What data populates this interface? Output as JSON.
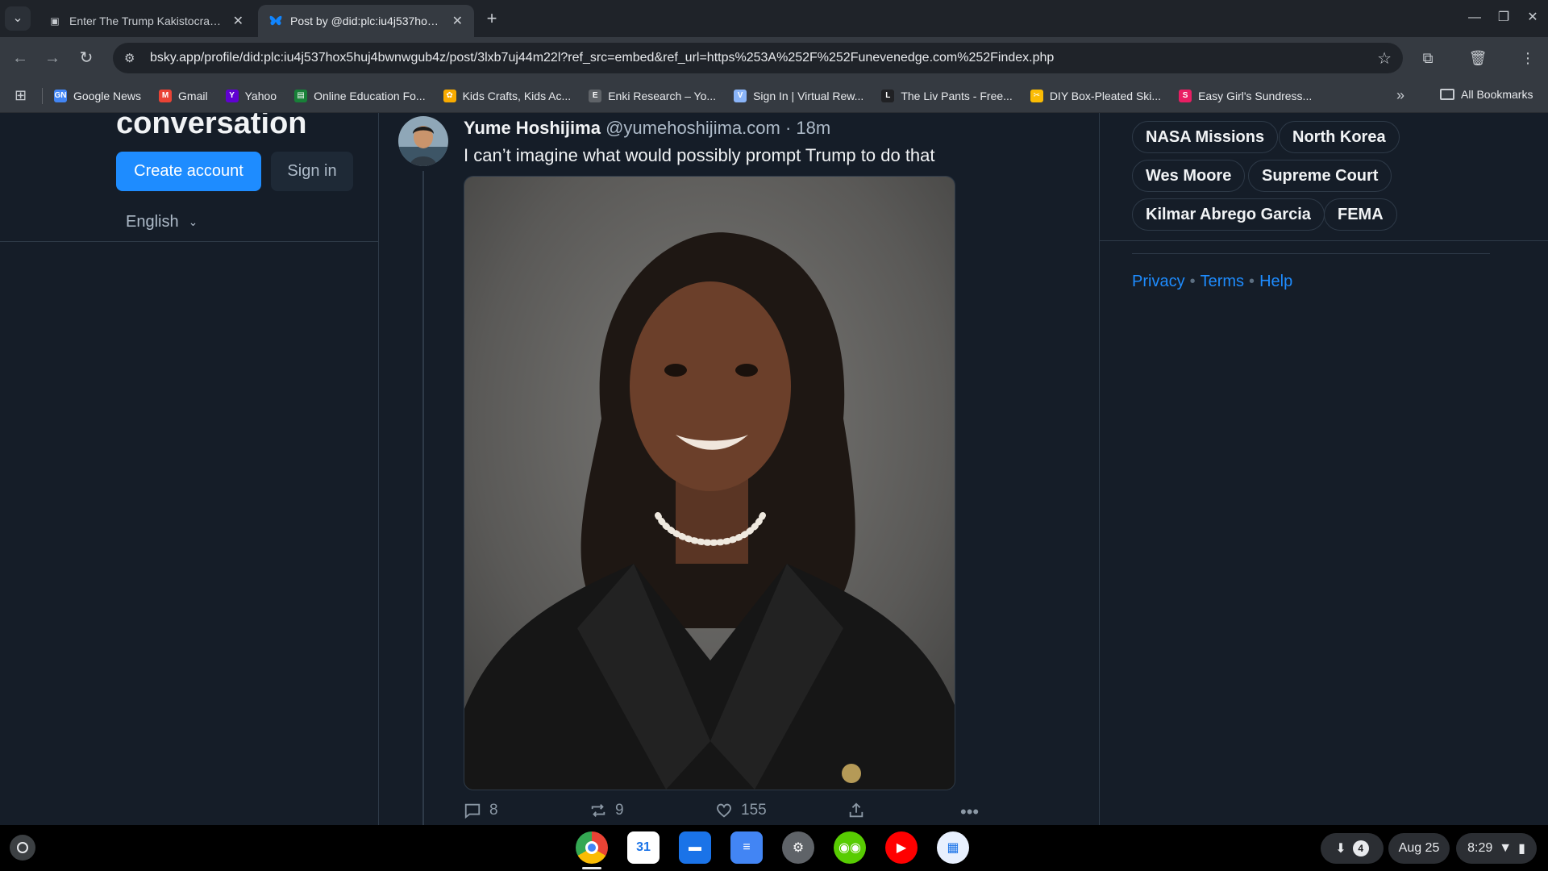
{
  "browser": {
    "tabs": [
      {
        "title": "Enter The Trump Kakistocracy...",
        "active": false
      },
      {
        "title": "Post by @did:plc:iu4j537hox5h...",
        "active": true
      }
    ],
    "url": "bsky.app/profile/did:plc:iu4j537hox5huj4bwnwgub4z/post/3lxb7uj44m22l?ref_src=embed&ref_url=https%253A%252F%252Funevenedge.com%252Findex.php",
    "bookmarks": [
      {
        "label": "Google News",
        "icon": "GN",
        "color": "#4285f4"
      },
      {
        "label": "Gmail",
        "icon": "M",
        "color": "#ea4335"
      },
      {
        "label": "Yahoo",
        "icon": "Y",
        "color": "#6001d2"
      },
      {
        "label": "Online Education Fo...",
        "icon": "▤",
        "color": "#188038"
      },
      {
        "label": "Kids Crafts, Kids Ac...",
        "icon": "✿",
        "color": "#f9ab00"
      },
      {
        "label": "Enki Research – Yo...",
        "icon": "E",
        "color": "#5f6368"
      },
      {
        "label": "Sign In | Virtual Rew...",
        "icon": "V",
        "color": "#8ab4f8"
      },
      {
        "label": "The Liv Pants - Free...",
        "icon": "L",
        "color": "#202124"
      },
      {
        "label": "DIY Box-Pleated Ski...",
        "icon": "✂",
        "color": "#fbbc04"
      },
      {
        "label": "Easy Girl's Sundress...",
        "icon": "S",
        "color": "#e91e63"
      }
    ],
    "all_bookmarks": "All Bookmarks"
  },
  "left": {
    "heading": "conversation",
    "create_account": "Create account",
    "sign_in": "Sign in",
    "language": "English"
  },
  "post": {
    "author": "Yume Hoshijima",
    "handle": "@yumehoshijima.com",
    "time": "· 18m",
    "text": "I can’t imagine what would possibly prompt Trump to do that",
    "replies": "8",
    "reposts": "9",
    "likes": "155"
  },
  "trending": {
    "chips": [
      "NASA Missions",
      "North Korea",
      "Wes Moore",
      "Supreme Court",
      "Kilmar Abrego Garcia",
      "FEMA"
    ]
  },
  "footer": {
    "privacy": "Privacy",
    "terms": "Terms",
    "help": "Help"
  },
  "shelf": {
    "date": "Aug 25",
    "time": "8:29",
    "notification_count": "4"
  },
  "colors": {
    "accent": "#1e8cff",
    "page_bg": "#151d28",
    "border": "#2e3a48"
  }
}
